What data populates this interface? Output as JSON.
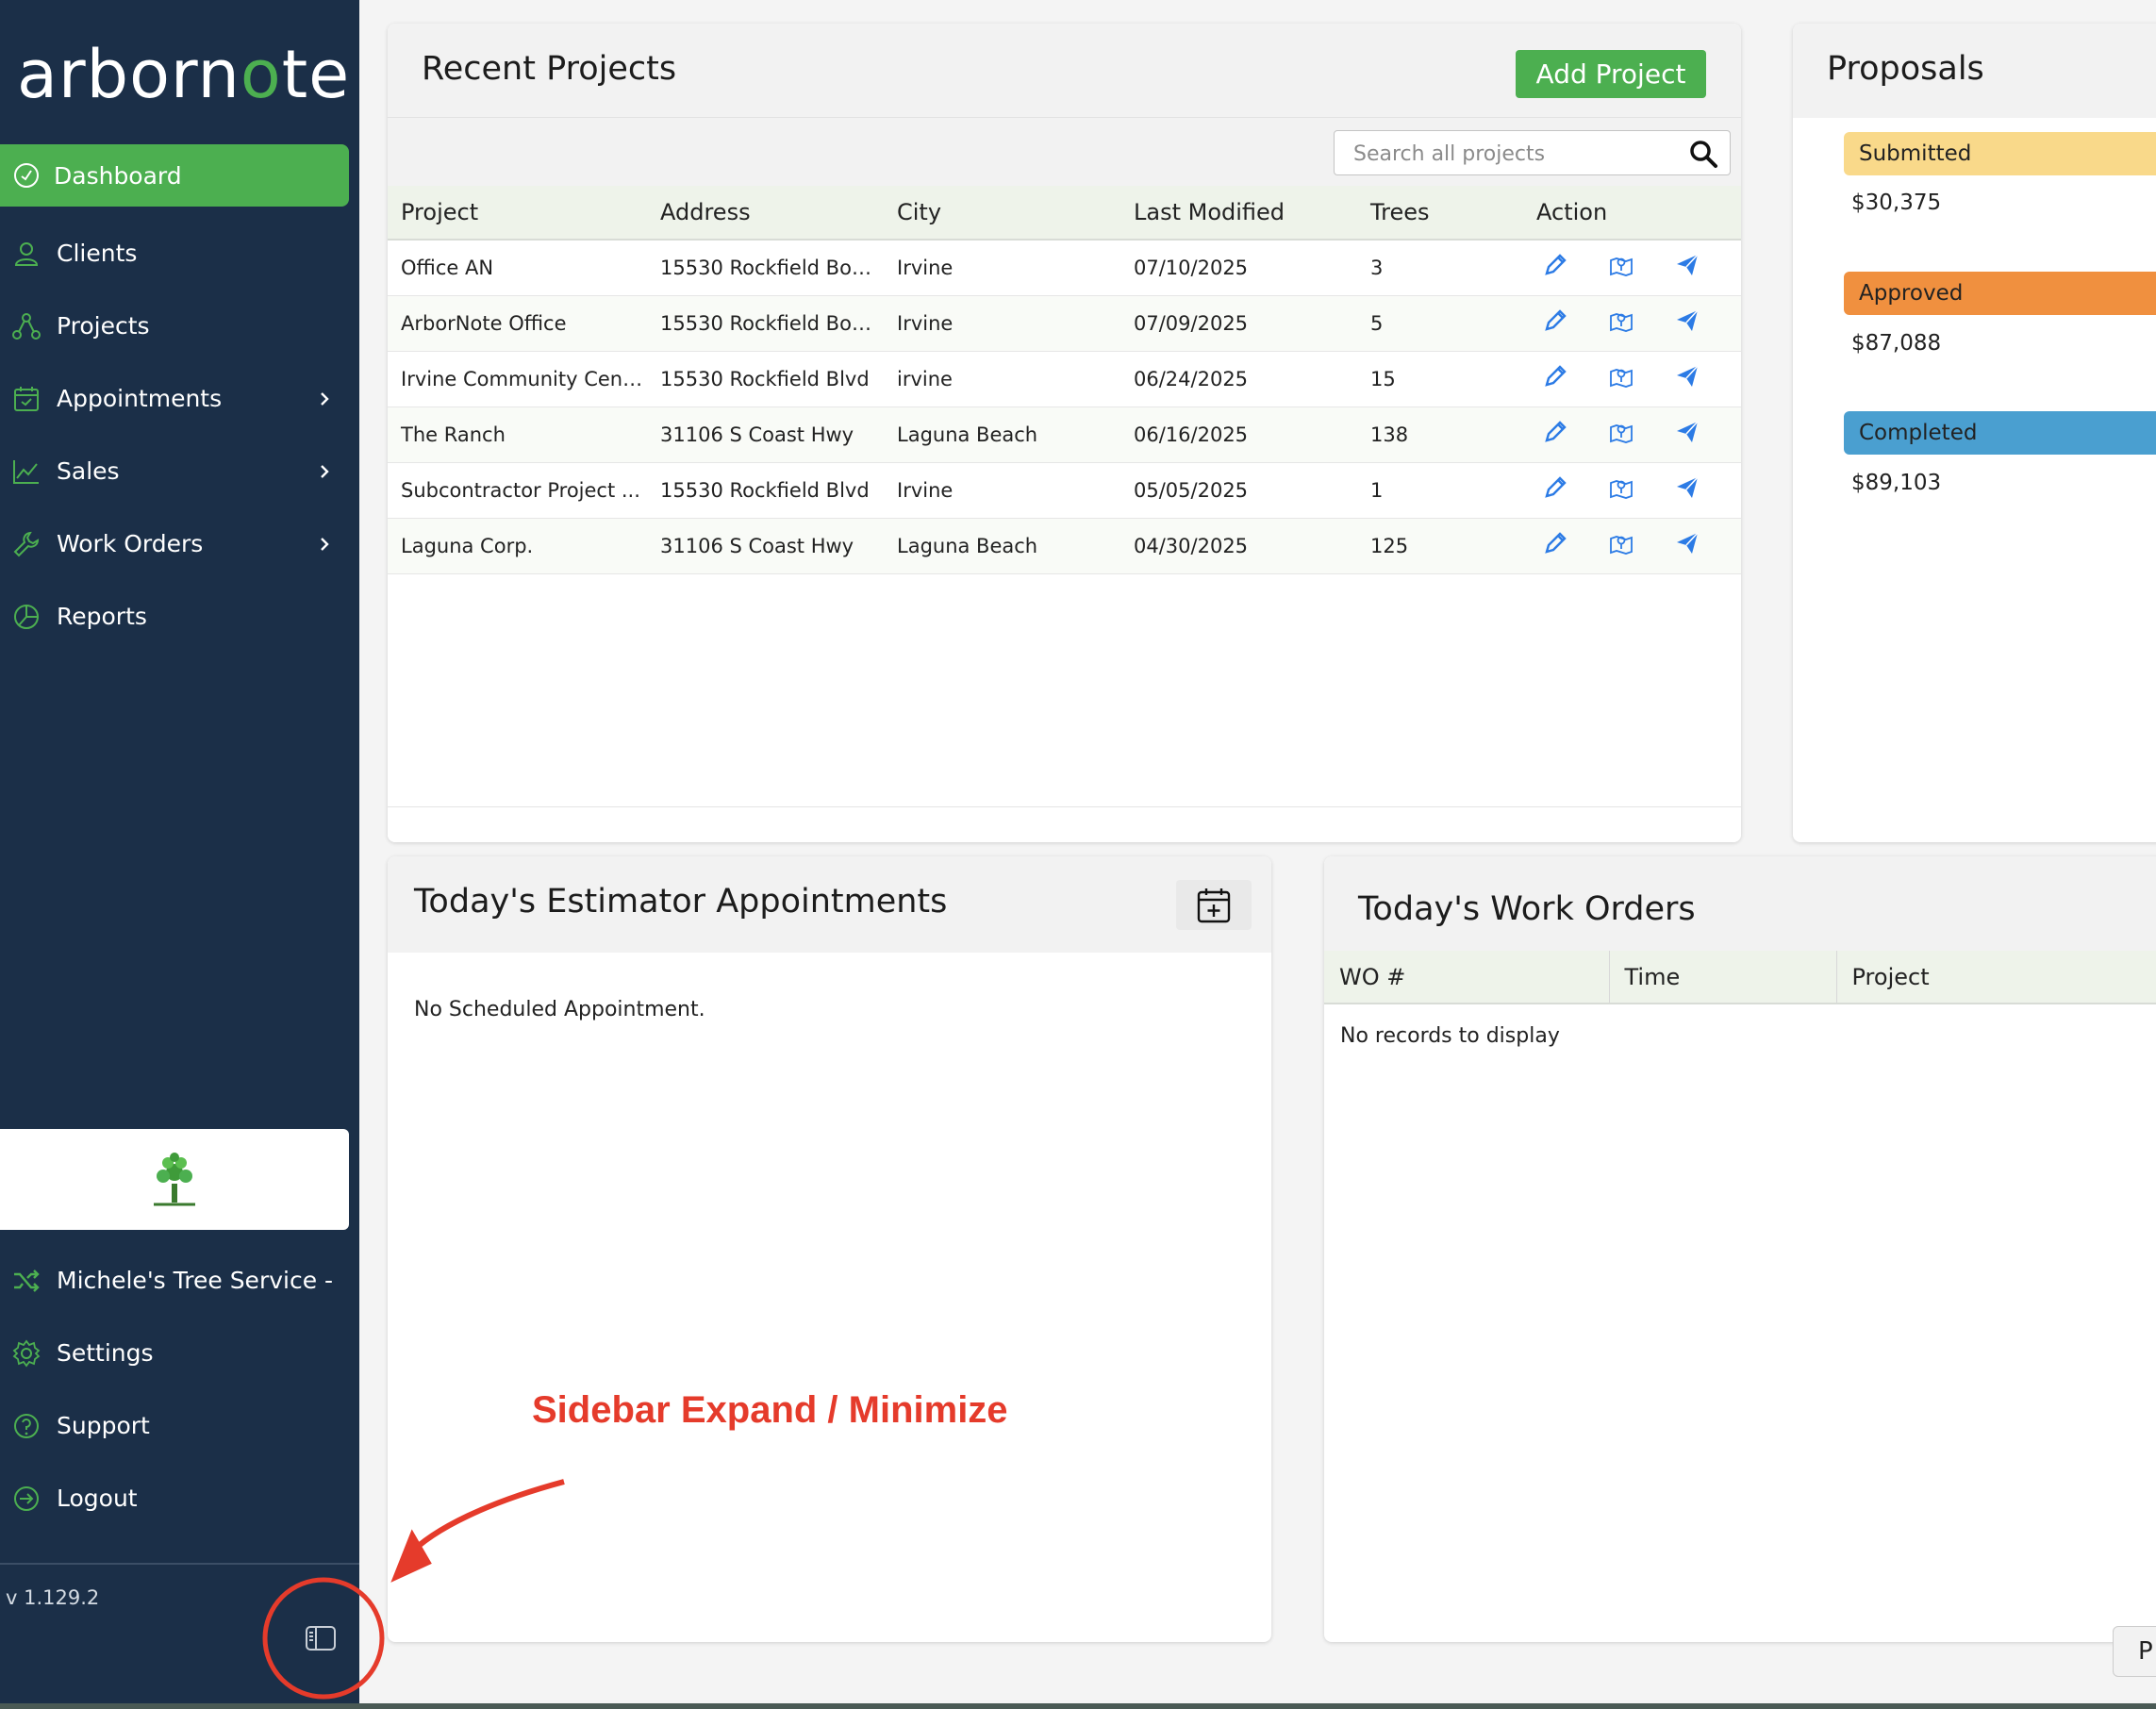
{
  "brand": {
    "logo_prefix": "arborn",
    "logo_o": "o",
    "logo_suffix": "te",
    "accent": "#4caf50",
    "sidebar_bg": "#1b2f48"
  },
  "sidebar": {
    "items": [
      {
        "label": "Dashboard",
        "icon": "gauge-icon",
        "active": true
      },
      {
        "label": "Clients",
        "icon": "user-icon"
      },
      {
        "label": "Projects",
        "icon": "nodes-icon"
      },
      {
        "label": "Appointments",
        "icon": "calendar-icon",
        "has_submenu": true
      },
      {
        "label": "Sales",
        "icon": "line-chart-icon",
        "has_submenu": true
      },
      {
        "label": "Work Orders",
        "icon": "wrench-icon",
        "has_submenu": true
      },
      {
        "label": "Reports",
        "icon": "pie-chart-icon"
      }
    ],
    "bottom_items": [
      {
        "label": "Michele's Tree Service -",
        "icon": "shuffle-icon"
      },
      {
        "label": "Settings",
        "icon": "gear-icon"
      },
      {
        "label": "Support",
        "icon": "help-circle-icon"
      },
      {
        "label": "Logout",
        "icon": "logout-icon"
      }
    ],
    "version": "v 1.129.2",
    "company_logo_icon": "tree-icon",
    "toggle_icon": "sidebar-toggle-icon"
  },
  "recent_projects": {
    "title": "Recent Projects",
    "add_button": "Add Project",
    "search_placeholder": "Search all projects",
    "columns": [
      "Project",
      "Address",
      "City",
      "Last Modified",
      "Trees",
      "Action"
    ],
    "rows": [
      {
        "project": "Office AN",
        "address": "15530 Rockfield Boul...",
        "city": "Irvine",
        "modified": "07/10/2025",
        "trees": "3"
      },
      {
        "project": "ArborNote Office",
        "address": "15530 Rockfield Boul...",
        "city": "Irvine",
        "modified": "07/09/2025",
        "trees": "5"
      },
      {
        "project": "Irvine Community Cent...",
        "address": "15530 Rockfield Blvd",
        "city": "irvine",
        "modified": "06/24/2025",
        "trees": "15"
      },
      {
        "project": "The Ranch",
        "address": "31106 S Coast Hwy",
        "city": "Laguna Beach",
        "modified": "06/16/2025",
        "trees": "138"
      },
      {
        "project": "Subcontractor Project ...",
        "address": "15530 Rockfield Blvd",
        "city": "Irvine",
        "modified": "05/05/2025",
        "trees": "1"
      },
      {
        "project": "Laguna Corp.",
        "address": "31106 S Coast Hwy",
        "city": "Laguna Beach",
        "modified": "04/30/2025",
        "trees": "125"
      }
    ],
    "action_icons": [
      "pencil-icon",
      "map-pin-icon",
      "send-icon"
    ]
  },
  "proposals": {
    "title": "Proposals",
    "statuses": [
      {
        "label": "Submitted",
        "amount": "$30,375",
        "color": "#f9d98a"
      },
      {
        "label": "Approved",
        "amount": "$87,088",
        "color": "#f0903f"
      },
      {
        "label": "Completed",
        "amount": "$89,103",
        "color": "#4a9fd0"
      }
    ]
  },
  "estimator": {
    "title": "Today's Estimator Appointments",
    "empty": "No Scheduled Appointment.",
    "add_icon": "calendar-plus-icon"
  },
  "work_orders": {
    "title": "Today's Work Orders",
    "columns": [
      "WO #",
      "Time",
      "Project"
    ],
    "empty": "No records to display"
  },
  "annotation": {
    "text": "Sidebar Expand / Minimize",
    "color": "#e53b2b"
  },
  "pager_stub": "P"
}
